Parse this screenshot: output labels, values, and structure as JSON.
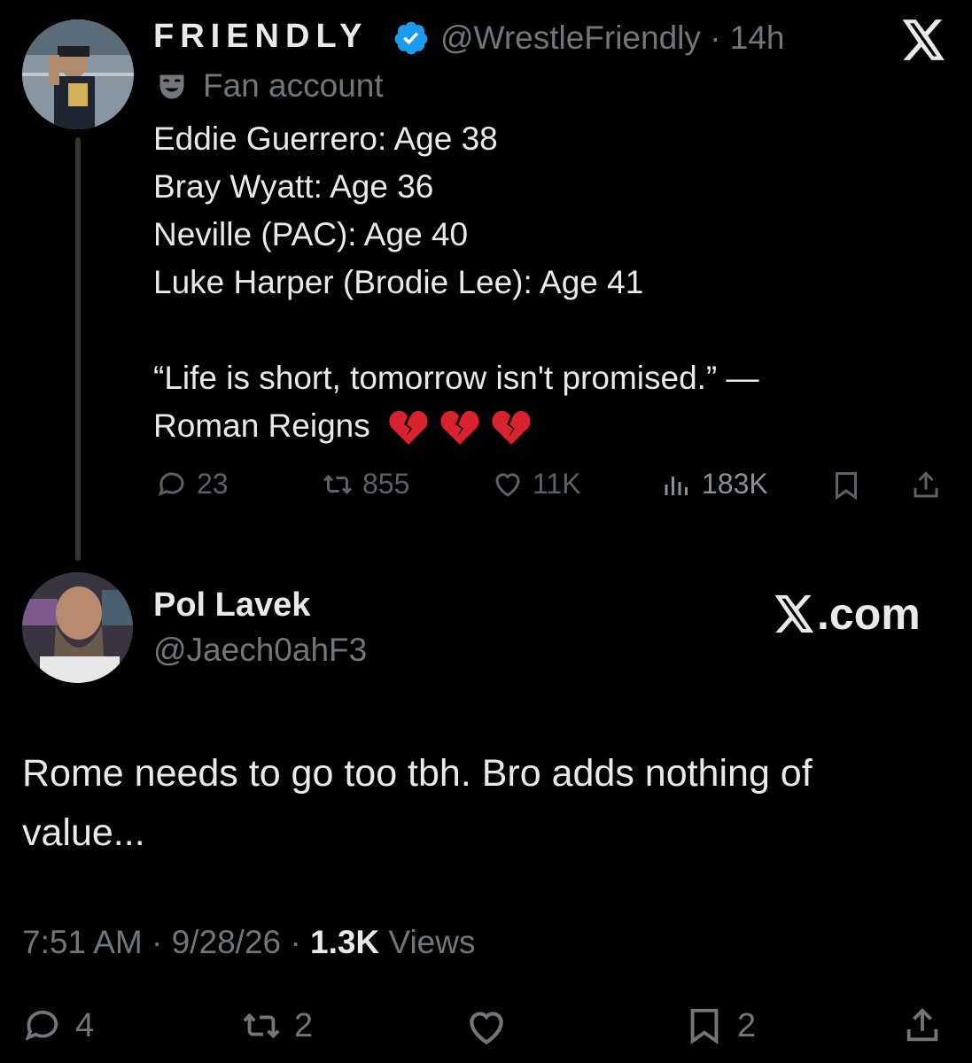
{
  "original_tweet": {
    "display_name": "FRIENDLY",
    "handle": "@WrestleFriendly",
    "separator": "·",
    "time_ago": "14h",
    "badge_label": "Fan account",
    "body_lines": [
      "Eddie Guerrero: Age 38",
      "Bray Wyatt: Age 36",
      "Neville (PAC): Age 40",
      "Luke Harper (Brodie Lee): Age 41"
    ],
    "quote_line1": "“Life is short, tomorrow isn't promised.” —",
    "quote_line2": "Roman Reigns",
    "emoji_icons": [
      "broken-heart-icon",
      "broken-heart-icon",
      "broken-heart-icon"
    ],
    "stats": {
      "replies": "23",
      "reposts": "855",
      "likes": "11K",
      "views": "183K"
    }
  },
  "reply": {
    "display_name": "Pol Lavek",
    "handle": "@Jaech0ahF3",
    "watermark": ".com",
    "text": "Rome needs to go too tbh. Bro adds nothing of value...",
    "meta": {
      "time": "7:51 AM",
      "date": "9/28/26",
      "views_count": "1.3K",
      "views_label": "Views"
    },
    "stats": {
      "replies": "4",
      "reposts": "2",
      "bookmarks": "2"
    }
  },
  "colors": {
    "background": "#000000",
    "primary_text": "#e7e9ea",
    "secondary_text": "#71767b",
    "verified_blue": "#1d9bf0",
    "broken_heart_red": "#d8232f"
  }
}
